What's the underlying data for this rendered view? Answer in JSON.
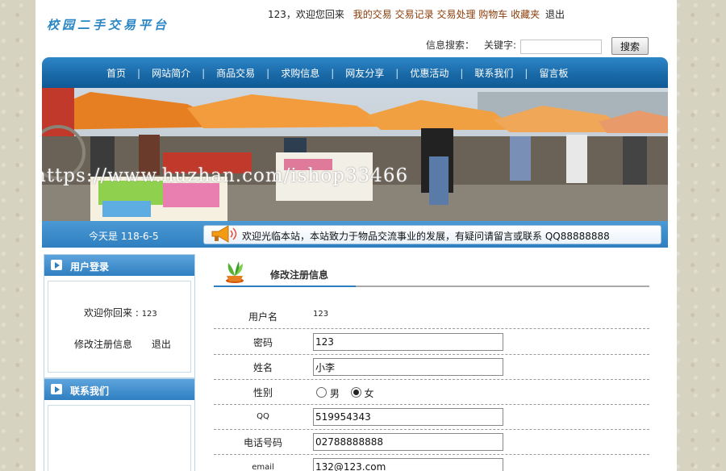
{
  "header": {
    "logo": "校园二手交易平台",
    "username": "123，",
    "welcome": "欢迎您回来",
    "links": [
      "我的交易",
      "交易记录",
      "交易处理",
      "购物车",
      "收藏夹"
    ],
    "logout": "退出"
  },
  "search": {
    "label": "信息搜索：",
    "keyword_label": "关键字:",
    "value": "",
    "button": "搜索"
  },
  "nav": {
    "items": [
      "首页",
      "网站简介",
      "商品交易",
      "求购信息",
      "网友分享",
      "优惠活动",
      "联系我们",
      "留言板"
    ],
    "separator": "|"
  },
  "banner": {
    "watermark": "https://www.huzhan.com/ishop33466"
  },
  "infobar": {
    "today": "今天是 118-6-5",
    "notice": "欢迎光临本站，本站致力于物品交流事业的发展，有疑问请留言或联系 QQ88888888"
  },
  "sidebar": {
    "login_title": "用户登录",
    "welcome_text": "欢迎你回来 :",
    "welcome_name": "123",
    "edit_link": "修改注册信息",
    "logout_link": "退出",
    "contact_title": "联系我们"
  },
  "form": {
    "title": "修改注册信息",
    "username_label": "用户名",
    "username_value": "123",
    "password_label": "密码",
    "password_value": "123",
    "name_label": "姓名",
    "name_value": "小李",
    "gender_label": "性别",
    "gender_options": [
      "男",
      "女"
    ],
    "gender_selected": "女",
    "qq_label": "QQ",
    "qq_value": "519954343",
    "phone_label": "电话号码",
    "phone_value": "02788888888",
    "email_label": "email",
    "email_value": "132@123.com"
  },
  "colors": {
    "nav_blue": "#1a6aa8",
    "link_brown": "#8a3c0a",
    "logo_blue": "#2a86c4",
    "page_bg": "#d7d3c1"
  }
}
